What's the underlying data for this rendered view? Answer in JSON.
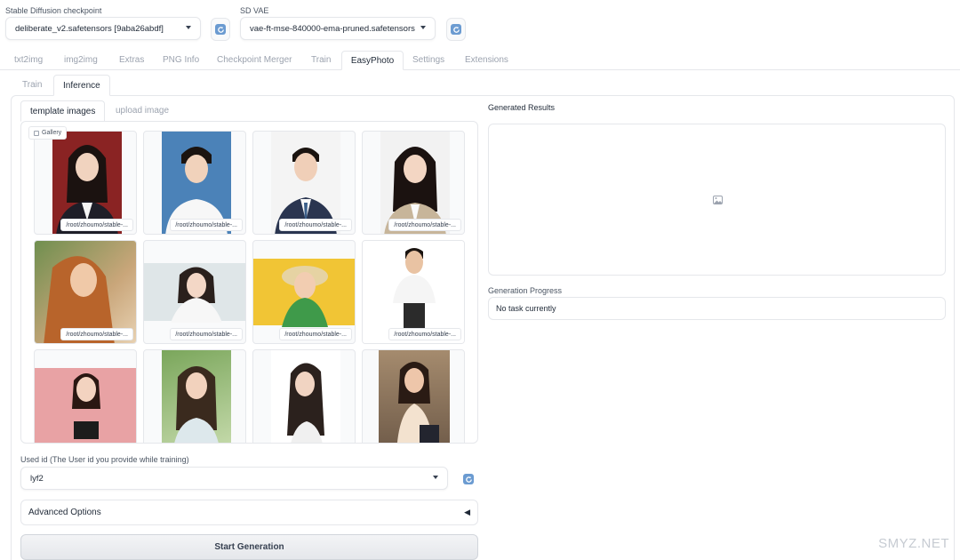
{
  "header": {
    "checkpoint_label": "Stable Diffusion checkpoint",
    "checkpoint_value": "deliberate_v2.safetensors [9aba26abdf]",
    "vae_label": "SD VAE",
    "vae_value": "vae-ft-mse-840000-ema-pruned.safetensors"
  },
  "main_tabs": [
    "txt2img",
    "img2img",
    "Extras",
    "PNG Info",
    "Checkpoint Merger",
    "Train",
    "EasyPhoto",
    "Settings",
    "Extensions"
  ],
  "sub_tabs": [
    "Train",
    "Inference"
  ],
  "image_tabs": [
    "template images",
    "upload image"
  ],
  "gallery": {
    "label": "Gallery",
    "caption": "/root/zhoumo/stable-..."
  },
  "user_id": {
    "label": "Used id (The User id you provide while training)",
    "value": "lyf2"
  },
  "advanced_label": "Advanced Options",
  "advanced_arrow": "◀",
  "start_button": "Start Generation",
  "results_label": "Generated Results",
  "progress_label": "Generation Progress",
  "progress_text": "No task currently",
  "watermark": "SMYZ.NET",
  "colors": {
    "accent": "#6b9bd1",
    "border": "#e5e7eb"
  },
  "icons": [
    "refresh-icon",
    "gallery-icon",
    "image-placeholder-icon",
    "caret-down-icon"
  ]
}
